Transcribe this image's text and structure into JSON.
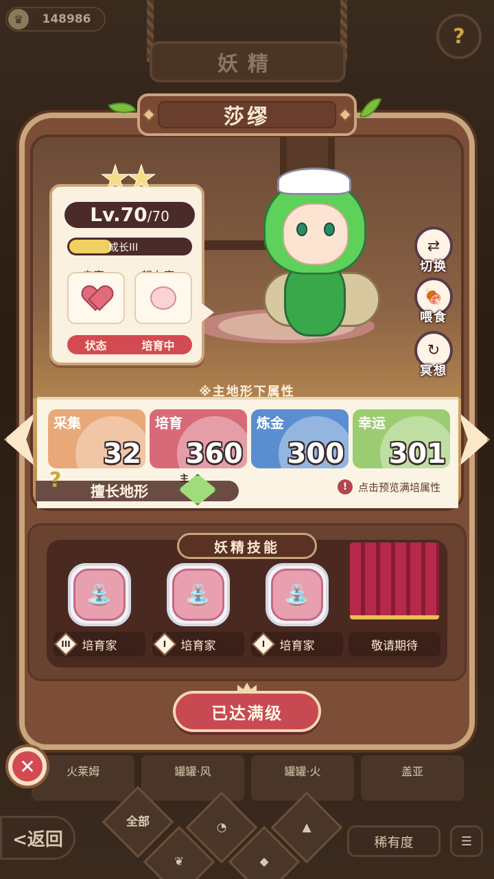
{
  "header": {
    "coins": "148986",
    "title": "妖精"
  },
  "fairy": {
    "name": "莎缪",
    "stars": 2,
    "level": "Lv.70",
    "level_max": "/70",
    "growth_label": "成长III",
    "growth_fraction": 0.35,
    "intimacy_label": "亲密",
    "effort_label": "努力度",
    "status_label": "状态",
    "status_value": "培育中"
  },
  "side_actions": [
    {
      "label": "切换",
      "icon": "switch-icon"
    },
    {
      "label": "喂食",
      "icon": "meat-icon"
    },
    {
      "label": "冥想",
      "icon": "meditate-icon"
    }
  ],
  "attributes": {
    "note": "※主地形下属性",
    "items": [
      {
        "name": "采集",
        "value": "32",
        "color": "#e8a878"
      },
      {
        "name": "培育",
        "value": "360",
        "color": "#d86a78"
      },
      {
        "name": "炼金",
        "value": "300",
        "color": "#5a8ed0"
      },
      {
        "name": "幸运",
        "value": "301",
        "color": "#9ccc72"
      }
    ],
    "terrain_label": "擅长地形",
    "main_tag": "主",
    "preview_hint": "点击预览满培属性"
  },
  "skills": {
    "title": "妖精技能",
    "items": [
      {
        "rank": "III",
        "label": "培育家"
      },
      {
        "rank": "I",
        "label": "培育家"
      },
      {
        "rank": "I",
        "label": "培育家"
      }
    ],
    "locked_label": "敬请期待"
  },
  "max_button": "已达满级",
  "bottom": {
    "cards": [
      "火莱姆",
      "罐罐·风",
      "罐罐·火",
      "盖亚"
    ],
    "back_label": "<返回",
    "filter_all": "全部",
    "rarity_label": "稀有度"
  }
}
